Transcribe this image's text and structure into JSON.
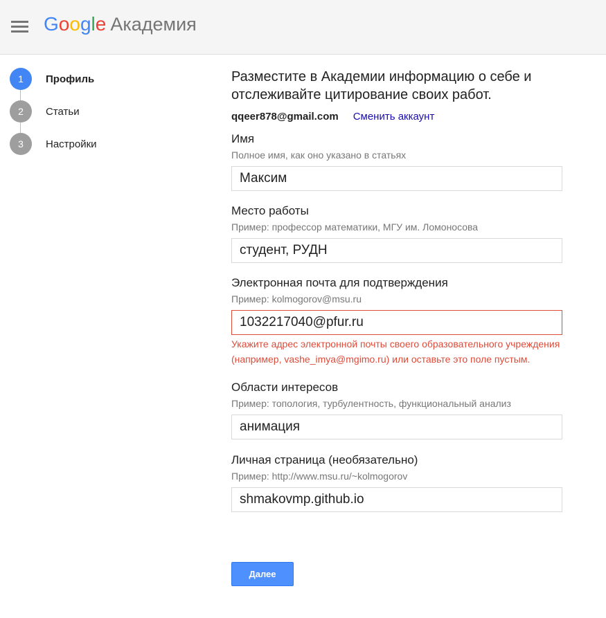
{
  "header": {
    "logo_letters": [
      {
        "char": "G",
        "color": "#4285f4"
      },
      {
        "char": "o",
        "color": "#ea4335"
      },
      {
        "char": "o",
        "color": "#fbbc05"
      },
      {
        "char": "g",
        "color": "#4285f4"
      },
      {
        "char": "l",
        "color": "#34a853"
      },
      {
        "char": "e",
        "color": "#ea4335"
      }
    ],
    "logo_suffix": "Академия"
  },
  "steps": [
    {
      "number": "1",
      "label": "Профиль",
      "active": true
    },
    {
      "number": "2",
      "label": "Статьи",
      "active": false
    },
    {
      "number": "3",
      "label": "Настройки",
      "active": false
    }
  ],
  "intro": "Разместите в Академии информацию о себе и отслеживайте цитирование своих работ.",
  "account": {
    "email": "qqeer878@gmail.com",
    "switch_label": "Сменить аккаунт"
  },
  "fields": {
    "name": {
      "label": "Имя",
      "hint": "Полное имя, как оно указано в статьях",
      "value": "Максим"
    },
    "affiliation": {
      "label": "Место работы",
      "hint": "Пример: профессор математики, МГУ им. Ломоносова",
      "value": "студент, РУДН"
    },
    "email": {
      "label": "Электронная почта для подтверждения",
      "hint": "Пример: kolmogorov@msu.ru",
      "value": "1032217040@pfur.ru",
      "error": "Укажите адрес электронной почты своего образовательного учреждения (например, vashe_imya@mgimo.ru) или оставьте это поле пустым."
    },
    "interests": {
      "label": "Области интересов",
      "hint": "Пример: топология, турбулентность, функциональный анализ",
      "value": "анимация"
    },
    "homepage": {
      "label": "Личная страница (необязательно)",
      "hint": "Пример: http://www.msu.ru/~kolmogorov",
      "value": "shmakovmp.github.io"
    }
  },
  "next_label": "Далее",
  "colors": {
    "accent": "#4285f4",
    "button": "#4d90fe",
    "error": "#dd4b39",
    "link": "#1a0dab"
  }
}
